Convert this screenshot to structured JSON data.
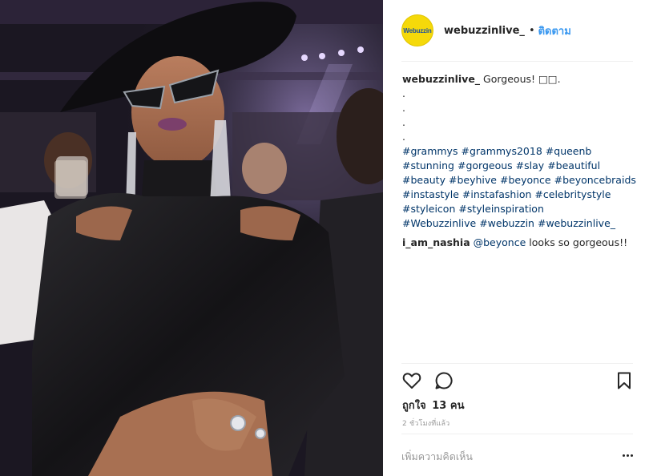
{
  "post": {
    "author": "webuzzinlive_",
    "avatar_text": "Webuzzin",
    "separator": "•",
    "follow_label": "ติดตาม",
    "caption": {
      "username": "webuzzinlive_",
      "text": "Gorgeous! □□.",
      "dots": [
        ".",
        ".",
        ".",
        "."
      ],
      "hashtags": [
        "#grammys",
        "#grammys2018",
        "#queenb",
        "#stunning",
        "#gorgeous",
        "#slay",
        "#beautiful",
        "#beauty",
        "#beyhive",
        "#beyonce",
        "#beyoncebraids",
        "#instastyle",
        "#instafashion",
        "#celebritystyle",
        "#styleicon",
        "#styleinspiration",
        "#Webuzzinlive",
        "#webuzzin",
        "#webuzzinlive_"
      ]
    },
    "comments": [
      {
        "username": "i_am_nashia",
        "mention": "@beyonce",
        "text": "looks so gorgeous!!"
      }
    ],
    "likes": {
      "label": "ถูกใจ",
      "count": "13 คน"
    },
    "timestamp": "2 ชั่วโมงที่แล้ว",
    "add_comment_placeholder": "เพิ่มความคิดเห็น",
    "icons": {
      "like": "heart-icon",
      "comment": "comment-bubble-icon",
      "save": "bookmark-icon",
      "more": "more-dots-icon"
    },
    "colors": {
      "link_blue": "#3897f0",
      "hashtag": "#003569",
      "muted": "#999999",
      "text": "#262626",
      "avatar_yellow": "#f5d90a"
    }
  }
}
